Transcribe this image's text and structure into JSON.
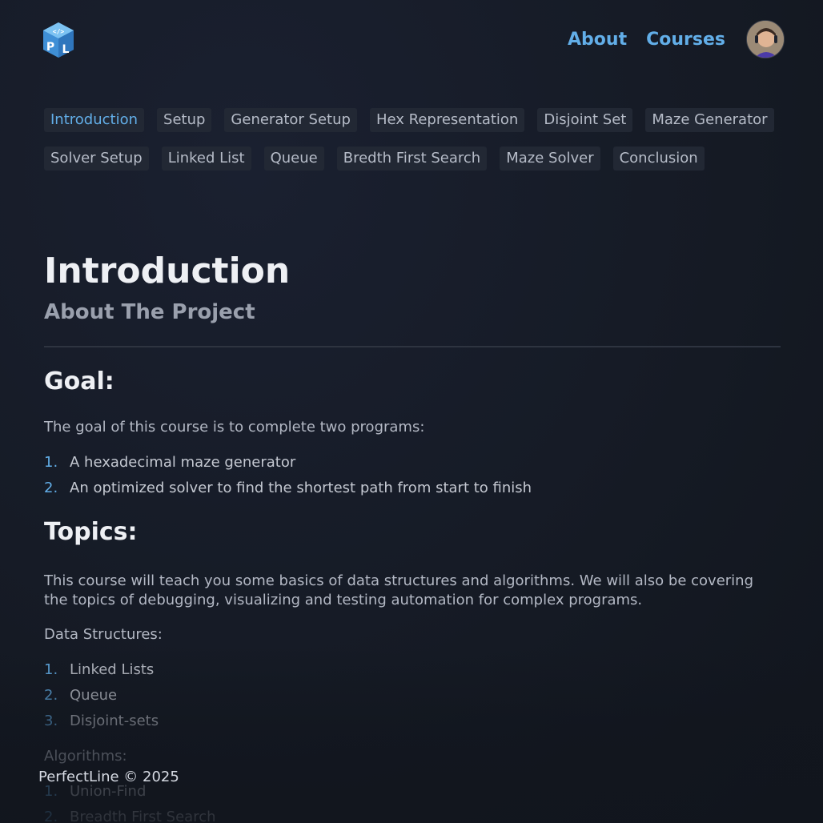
{
  "nav": {
    "about_label": "About",
    "courses_label": "Courses",
    "accent_color": "#62aee8"
  },
  "chapters": [
    {
      "label": "Introduction",
      "active": true
    },
    {
      "label": "Setup"
    },
    {
      "label": "Generator Setup"
    },
    {
      "label": "Hex Representation"
    },
    {
      "label": "Disjoint Set"
    },
    {
      "label": "Maze Generator"
    },
    {
      "label": "Solver Setup"
    },
    {
      "label": "Linked List"
    },
    {
      "label": "Queue"
    },
    {
      "label": "Bredth First Search"
    },
    {
      "label": "Maze Solver"
    },
    {
      "label": "Conclusion"
    }
  ],
  "page": {
    "title": "Introduction",
    "subtitle": "About The Project"
  },
  "goal": {
    "heading": "Goal:",
    "intro": "The goal of this course is to complete two programs:",
    "items": [
      "A hexadecimal maze generator",
      "An optimized solver to find the shortest path from start to finish"
    ]
  },
  "topics": {
    "heading": "Topics:",
    "intro": "This course will teach you some basics of data structures and algorithms. We will also be covering the topics of debugging, visualizing and testing automation for complex programs.",
    "data_structures_label": "Data Structures:",
    "data_structures": [
      "Linked Lists",
      "Queue",
      "Disjoint-sets"
    ],
    "algorithms_label": "Algorithms:",
    "algorithms": [
      "Union-Find",
      "Breadth First Search"
    ]
  },
  "footer": {
    "text": "PerfectLine © 2025"
  }
}
